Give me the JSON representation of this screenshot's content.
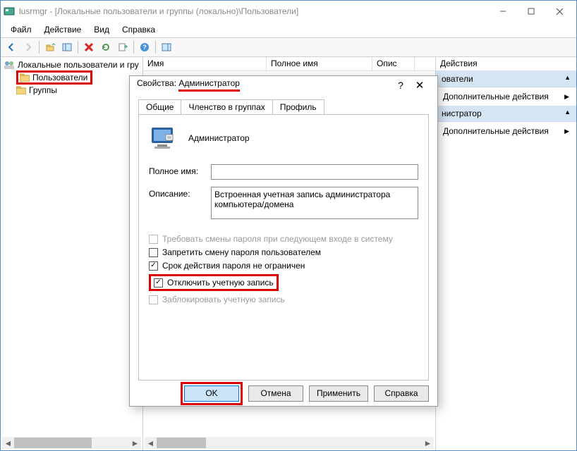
{
  "window": {
    "title": "lusrmgr - [Локальные пользователи и группы (локально)\\Пользователи]"
  },
  "menubar": {
    "file": "Файл",
    "action": "Действие",
    "view": "Вид",
    "help": "Справка"
  },
  "tree": {
    "root": "Локальные пользователи и гру",
    "users": "Пользователи",
    "groups": "Группы"
  },
  "columns": {
    "name": "Имя",
    "fullname": "Полное имя",
    "desc": "Опис"
  },
  "actions": {
    "header": "Действия",
    "band1": "ователи",
    "extra1": "Дополнительные действия",
    "band2": "нистратор",
    "extra2": "Дополнительные действия"
  },
  "dialog": {
    "title_prefix": "Свойства: ",
    "title_name": "Администратор",
    "tabs": {
      "general": "Общие",
      "membership": "Членство в группах",
      "profile": "Профиль"
    },
    "user_label": "Администратор",
    "fullname_lbl": "Полное имя:",
    "fullname_val": "",
    "desc_lbl": "Описание:",
    "desc_val": "Встроенная учетная запись администратора компьютера/домена",
    "chk_changepw": "Требовать смены пароля при следующем входе в систему",
    "chk_nochange": "Запретить смену пароля пользователем",
    "chk_neverexp": "Срок действия пароля не ограничен",
    "chk_disable": "Отключить учетную запись",
    "chk_locked": "Заблокировать учетную запись",
    "btn_ok": "OK",
    "btn_cancel": "Отмена",
    "btn_apply": "Применить",
    "btn_help": "Справка"
  }
}
